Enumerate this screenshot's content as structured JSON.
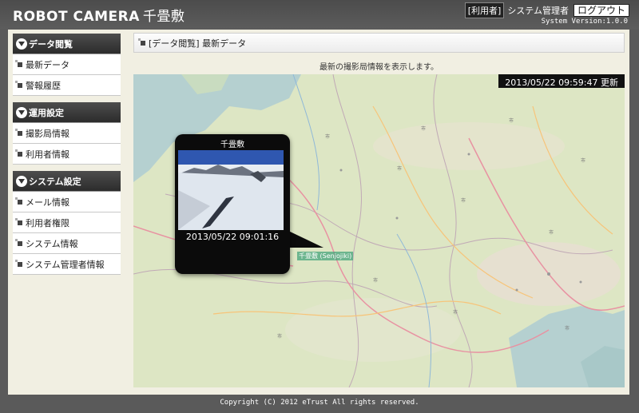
{
  "header": {
    "brand": "ROBOT CAMERA",
    "site": "千畳敷",
    "role_badge": "[利用者]",
    "user_name": "システム管理者",
    "logout_label": "ログアウト",
    "version": "System Version:1.0.0"
  },
  "sidebar": {
    "sections": [
      {
        "title": "データ閲覧",
        "items": [
          "最新データ",
          "警報履歴"
        ]
      },
      {
        "title": "運用設定",
        "items": [
          "撮影局情報",
          "利用者情報"
        ]
      },
      {
        "title": "システム設定",
        "items": [
          "メール情報",
          "利用者権限",
          "システム情報",
          "システム管理者情報"
        ]
      }
    ]
  },
  "breadcrumb": "[データ閲覧] 最新データ",
  "description": "最新の撮影局情報を表示します。",
  "map": {
    "updated": "2013/05/22 09:59:47 更新",
    "popup": {
      "title": "千畳敷",
      "timestamp": "2013/05/22 09:01:16"
    },
    "marker_label": "千畳敷 (Senjojiki)"
  },
  "footer": "Copyright (C) 2012 eTrust All rights reserved."
}
